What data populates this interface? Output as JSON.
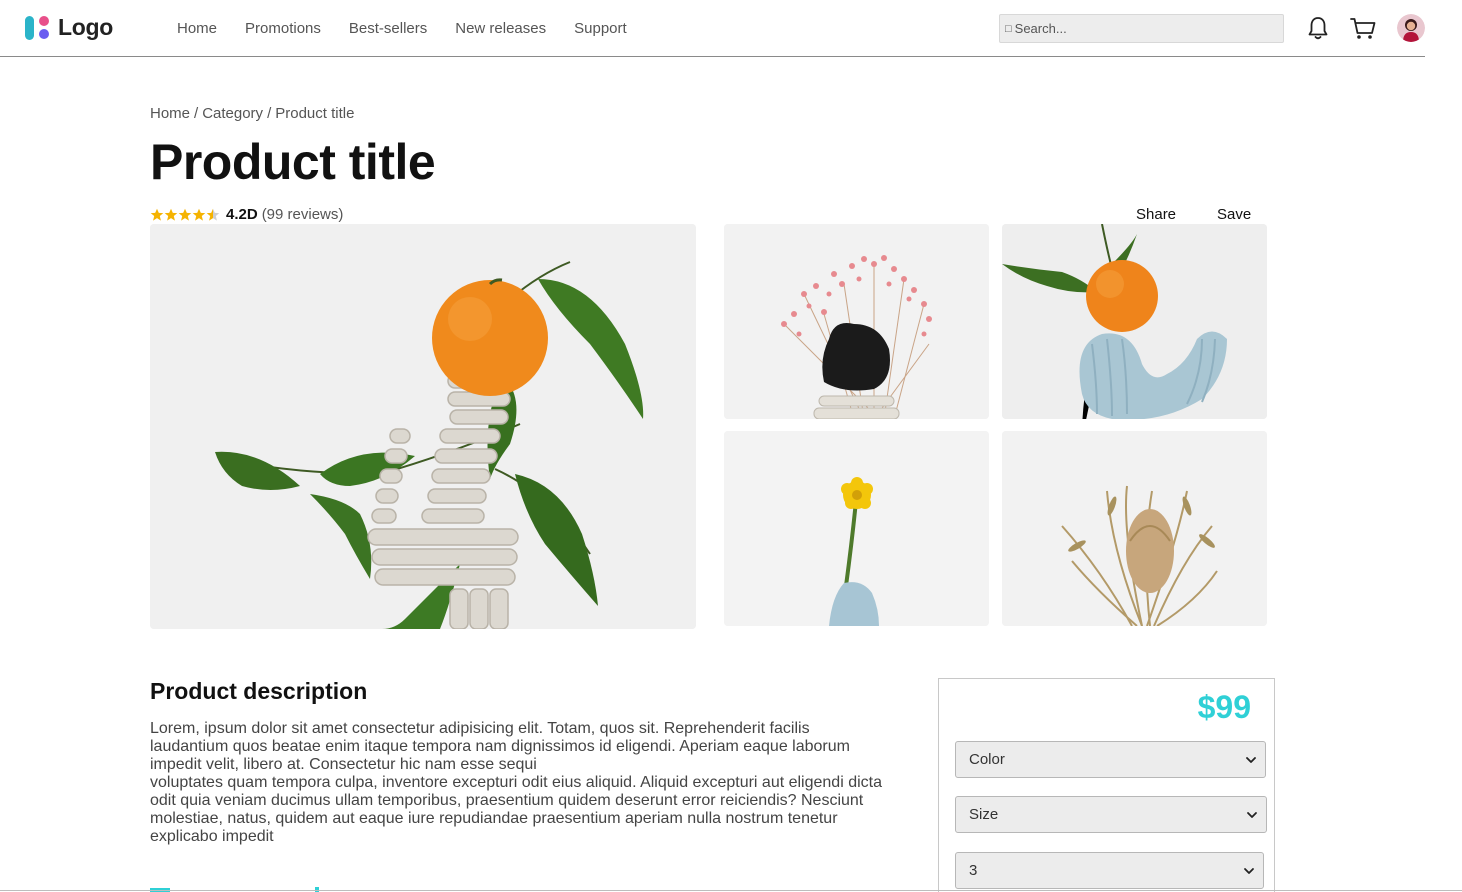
{
  "header": {
    "logo_text": "Logo",
    "nav": [
      "Home",
      "Promotions",
      "Best-sellers",
      "New releases",
      "Support"
    ],
    "search_placeholder": "Search...",
    "search_icon": "search-icon",
    "icons": [
      "bell-icon",
      "cart-icon",
      "avatar"
    ]
  },
  "breadcrumb": [
    "Home",
    "Category",
    "Product title"
  ],
  "product": {
    "title": "Product title",
    "rating_value": "4.2D",
    "rating_count": "(99 reviews)",
    "stars": 4.5,
    "share_label": "Share",
    "save_label": "Save"
  },
  "gallery": [
    "tangerine-on-clay-sculpture",
    "dried-pink-flowers-black-stone",
    "tangerine-on-blue-vase",
    "yellow-flower-blue-vase",
    "dried-protea-flowers"
  ],
  "description": {
    "heading": "Product description",
    "paragraphs": [
      "Lorem, ipsum dolor sit amet consectetur adipisicing elit. Totam, quos sit. Reprehenderit facilis laudantium quos beatae enim itaque tempora nam dignissimos id eligendi. Aperiam eaque laborum impedit velit, libero at. Consectetur hic nam esse sequi",
      "voluptates quam tempora culpa, inventore excepturi odit eius aliquid. Aliquid excepturi aut eligendi dicta odit quia veniam ducimus ullam temporibus, praesentium quidem deserunt error reiciendis? Nesciunt molestiae, natus, quidem aut eaque iure repudiandae praesentium aperiam nulla nostrum tenetur explicabo impedit"
    ]
  },
  "purchase": {
    "price": "$99",
    "price_color": "#2fd0d6",
    "color_select": "Color",
    "size_select": "Size",
    "quantity_select": "3"
  }
}
